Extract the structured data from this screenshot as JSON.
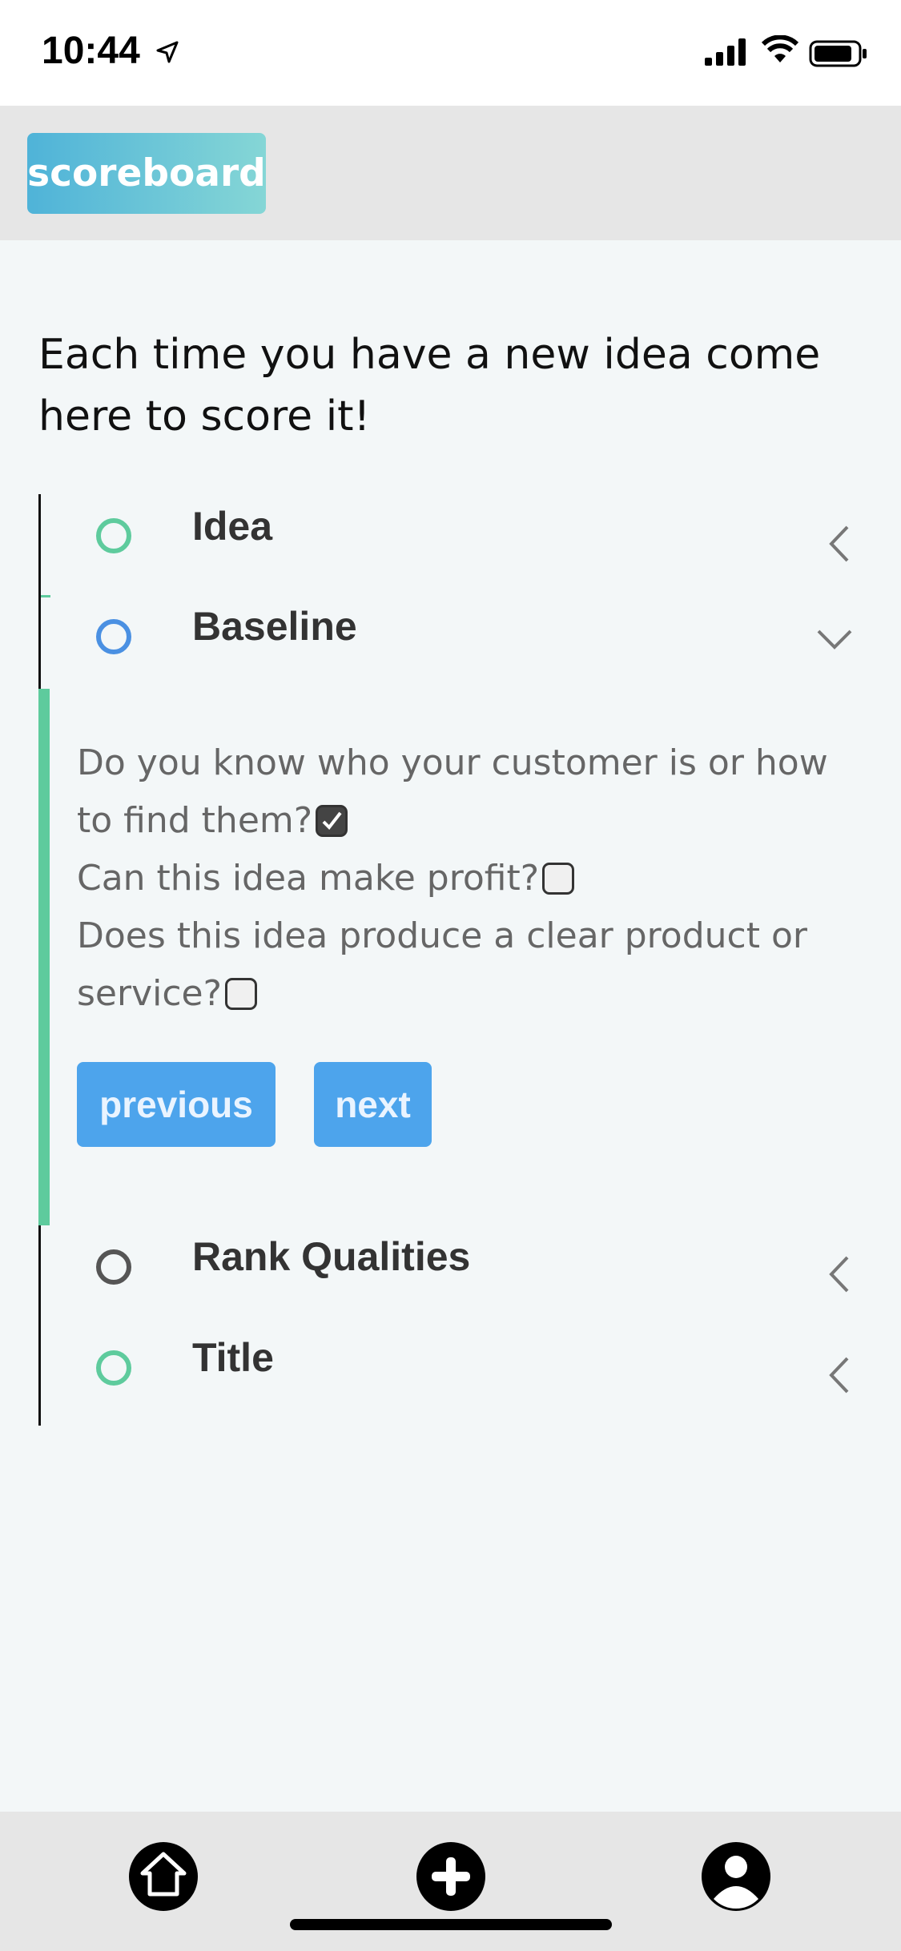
{
  "status_bar": {
    "time": "10:44",
    "icons": [
      "location-arrow-icon",
      "cellular-signal-icon",
      "wifi-icon",
      "battery-icon"
    ]
  },
  "header": {
    "logo_text": "scoreboard"
  },
  "intro": {
    "text": "Each time you have a new idea come here to score it!"
  },
  "steps": [
    {
      "label": "Idea",
      "circle_color": "#5ecb9d",
      "state": "collapsed"
    },
    {
      "label": "Baseline",
      "circle_color": "#4a90e2",
      "state": "expanded"
    },
    {
      "label": "Rank Qualities",
      "circle_color": "#555555",
      "state": "collapsed"
    },
    {
      "label": "Title",
      "circle_color": "#5ecb9d",
      "state": "collapsed"
    }
  ],
  "baseline": {
    "questions": [
      {
        "text": "Do you know who your customer is or how to find them?",
        "checked": true
      },
      {
        "text": "Can this idea make profit?",
        "checked": false
      },
      {
        "text": "Does this idea produce a clear product or service?",
        "checked": false
      }
    ],
    "previous_label": "previous",
    "next_label": "next"
  },
  "tab_bar": {
    "items": [
      "home-icon",
      "add-icon",
      "profile-icon"
    ]
  },
  "colors": {
    "accent_green": "#5ecb9d",
    "button_blue": "#4da4ec",
    "logo_gradient_start": "#4fb3d8",
    "logo_gradient_end": "#85d6d6"
  }
}
